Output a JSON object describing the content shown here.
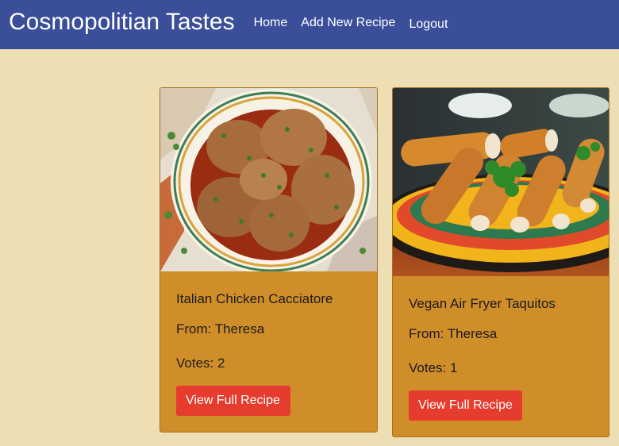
{
  "navbar": {
    "brand": "Cosmopolitian Tastes",
    "links": [
      "Home",
      "Add New Recipe",
      "Logout"
    ]
  },
  "recipes": [
    {
      "title": "Italian Chicken Cacciatore",
      "author": "From: Theresa",
      "votes": "Votes: 2",
      "button_label": "View Full Recipe",
      "image_icon": "chicken-cacciatore-photo"
    },
    {
      "title": "Vegan Air Fryer Taquitos",
      "author": "From: Theresa",
      "votes": "Votes: 1",
      "button_label": "View Full Recipe",
      "image_icon": "taquitos-photo"
    }
  ],
  "colors": {
    "page_background": "#EDDFB3",
    "navbar": "#3B4E9A",
    "card": "#D08E2A",
    "button": "#E53C2E"
  }
}
